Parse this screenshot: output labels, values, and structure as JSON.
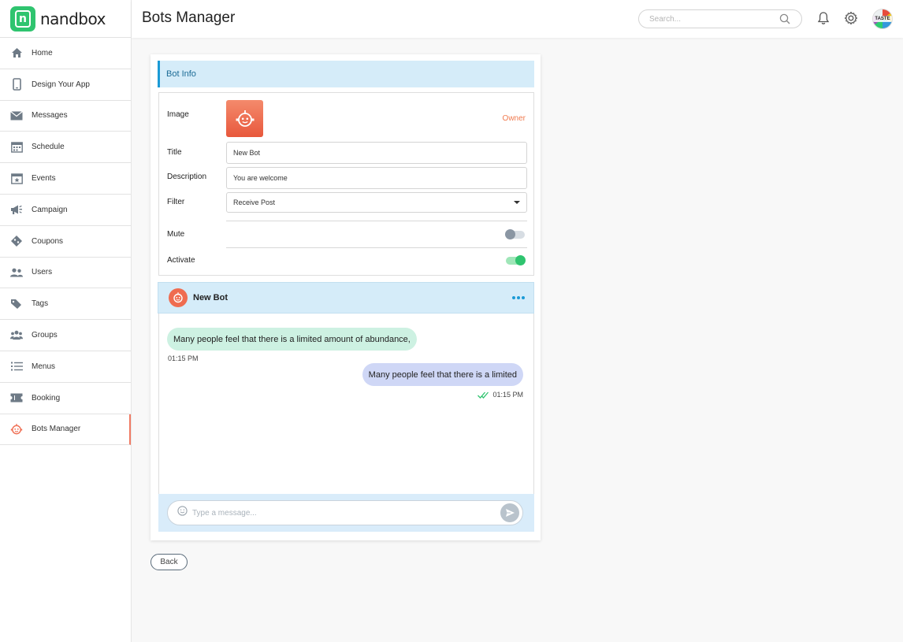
{
  "brand": {
    "name": "nandbox",
    "color": "#2fc46f"
  },
  "header": {
    "title": "Bots Manager",
    "search_placeholder": "Search...",
    "avatar_text": "TASTE"
  },
  "sidebar": {
    "items": [
      {
        "label": "Home",
        "icon": "home-icon"
      },
      {
        "label": "Design Your App",
        "icon": "phone-icon"
      },
      {
        "label": "Messages",
        "icon": "envelope-icon"
      },
      {
        "label": "Schedule",
        "icon": "calendar-icon"
      },
      {
        "label": "Events",
        "icon": "event-icon"
      },
      {
        "label": "Campaign",
        "icon": "megaphone-icon"
      },
      {
        "label": "Coupons",
        "icon": "coupon-icon"
      },
      {
        "label": "Users",
        "icon": "users-icon"
      },
      {
        "label": "Tags",
        "icon": "tag-icon"
      },
      {
        "label": "Groups",
        "icon": "groups-icon"
      },
      {
        "label": "Menus",
        "icon": "list-icon"
      },
      {
        "label": "Booking",
        "icon": "ticket-icon"
      },
      {
        "label": "Bots Manager",
        "icon": "bot-icon",
        "active": true
      }
    ]
  },
  "bot_info": {
    "section_title": "Bot Info",
    "image_label": "Image",
    "owner_label": "Owner",
    "title_label": "Title",
    "title_value": "New Bot",
    "description_label": "Description",
    "description_value": "You are welcome",
    "filter_label": "Filter",
    "filter_value": "Receive Post",
    "mute_label": "Mute",
    "mute_on": false,
    "activate_label": "Activate",
    "activate_on": true
  },
  "chat": {
    "title": "New Bot",
    "messages": [
      {
        "direction": "in",
        "text": "Many people feel that there is a limited amount of abundance,",
        "time": "01:15 PM"
      },
      {
        "direction": "out",
        "text": "Many people feel that there is a limited",
        "time": "01:15 PM"
      }
    ],
    "input_placeholder": "Type a message..."
  },
  "actions": {
    "back_label": "Back"
  },
  "colors": {
    "accent": "#1b9ad6",
    "bot": "#ef6c50",
    "active_toggle": "#2fc46f",
    "owner": "#f07a4f"
  }
}
